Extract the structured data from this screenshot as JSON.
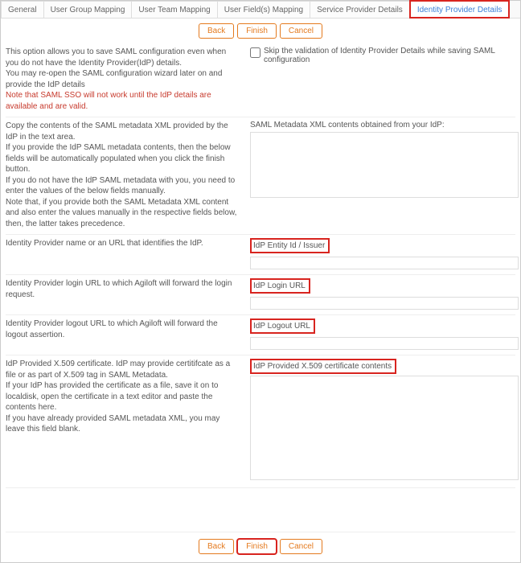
{
  "tabs": {
    "general": "General",
    "user_group": "User Group Mapping",
    "user_team": "User Team Mapping",
    "user_fields": "User Field(s) Mapping",
    "spd": "Service Provider Details",
    "ipd": "Identity Provider Details"
  },
  "buttons": {
    "back": "Back",
    "finish": "Finish",
    "cancel": "Cancel"
  },
  "opt_save": {
    "line1": "This option allows you to save SAML configuration even when you do not have the Identity Provider(IdP) details.",
    "line2": "You may re-open the SAML configuration wizard later on and provide the IdP details",
    "warn": "Note that SAML SSO will not work until the IdP details are available and are valid."
  },
  "skip_checkbox": "Skip the validation of Identity Provider Details while saving SAML configuration",
  "meta_desc": {
    "l1": "Copy the contents of the SAML metadata XML provided by the IdP in the text area.",
    "l2": "If you provide the IdP SAML metadata contents, then the below fields will be automatically populated when you click the finish button.",
    "l3": "If you do not have the IdP SAML metadata with you, you need to enter the values of the below fields manually.",
    "l4": "Note that, if you provide both the SAML Metadata XML content and also enter the values manually in the respective fields below, then, the latter takes precedence."
  },
  "meta_label": "SAML Metadata XML contents obtained from your IdP:",
  "entity": {
    "desc": "Identity Provider name or an URL that identifies the IdP.",
    "label": "IdP Entity Id / Issuer"
  },
  "login": {
    "desc": "Identity Provider login URL to which Agiloft will forward the login request.",
    "label": "IdP Login URL"
  },
  "logout": {
    "desc": "Identity Provider logout URL to which Agiloft will forward the logout assertion.",
    "label": "IdP Logout URL"
  },
  "cert": {
    "l1": "IdP Provided X.509 certificate. IdP may provide certitifcate as a file or as part of X.509 tag in SAML Metadata.",
    "l2": "If your IdP has provided the certificate as a file, save it on to localdisk, open the certificate in a text editor and paste the contents here.",
    "l3": "If you have already provided SAML metadata XML, you may leave this field blank.",
    "label": "IdP Provided X.509 certificate contents"
  }
}
